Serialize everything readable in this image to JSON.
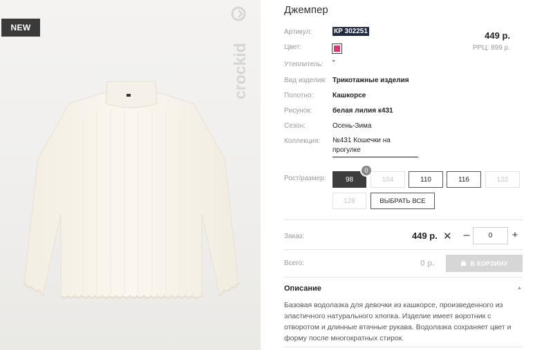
{
  "badge": {
    "new": "NEW"
  },
  "brand": {
    "name": "crockid"
  },
  "product": {
    "title": "Джемпер",
    "price": "449 р.",
    "rrp": "РРЦ: 899 р.",
    "color_hex": "#e0336f",
    "attributes": {
      "article_label": "Артикул:",
      "article_value": "КР 302251",
      "color_label": "Цвет:",
      "insulation_label": "Утеплитель:",
      "insulation_value": "\"",
      "type_label": "Вид изделия:",
      "type_value": "Трикотажные изделия",
      "fabric_label": "Полотно:",
      "fabric_value": "Кашкорсе",
      "print_label": "Рисунок:",
      "print_value": "белая лилия к431",
      "season_label": "Сезон:",
      "season_value": "Осень-Зима",
      "collection_label": "Коллекция:",
      "collection_value": "№431 Кошечки на прогулке"
    }
  },
  "sizes": {
    "label": "Рост/размер:",
    "selected_count": "0",
    "items": [
      {
        "label": "98",
        "state": "selected"
      },
      {
        "label": "104",
        "state": "disabled"
      },
      {
        "label": "110",
        "state": "available"
      },
      {
        "label": "116",
        "state": "available"
      },
      {
        "label": "122",
        "state": "disabled"
      },
      {
        "label": "128",
        "state": "disabled"
      }
    ],
    "select_all": "ВЫБРАТЬ ВСЕ"
  },
  "order": {
    "label": "Заказ:",
    "price": "449 р.",
    "times": "✕",
    "minus": "–",
    "quantity": "0",
    "plus": "+"
  },
  "total": {
    "label": "Всего:",
    "value": "0 р.",
    "cart_button": "В КОРЗИНУ"
  },
  "description": {
    "title": "Описание",
    "text": "Базовая водолазка для девочки из кашкорсе, произведенного из эластичного натурального хлопка. Изделие имеет воротник с отворотом и длинные втачные рукава. Водолазка сохраняет цвет и форму после многократных стирок."
  },
  "icons": {
    "times": "close-icon",
    "collapse": "chevron-up-icon",
    "cart": "cart-icon",
    "brand": "crockid-logo-icon"
  }
}
